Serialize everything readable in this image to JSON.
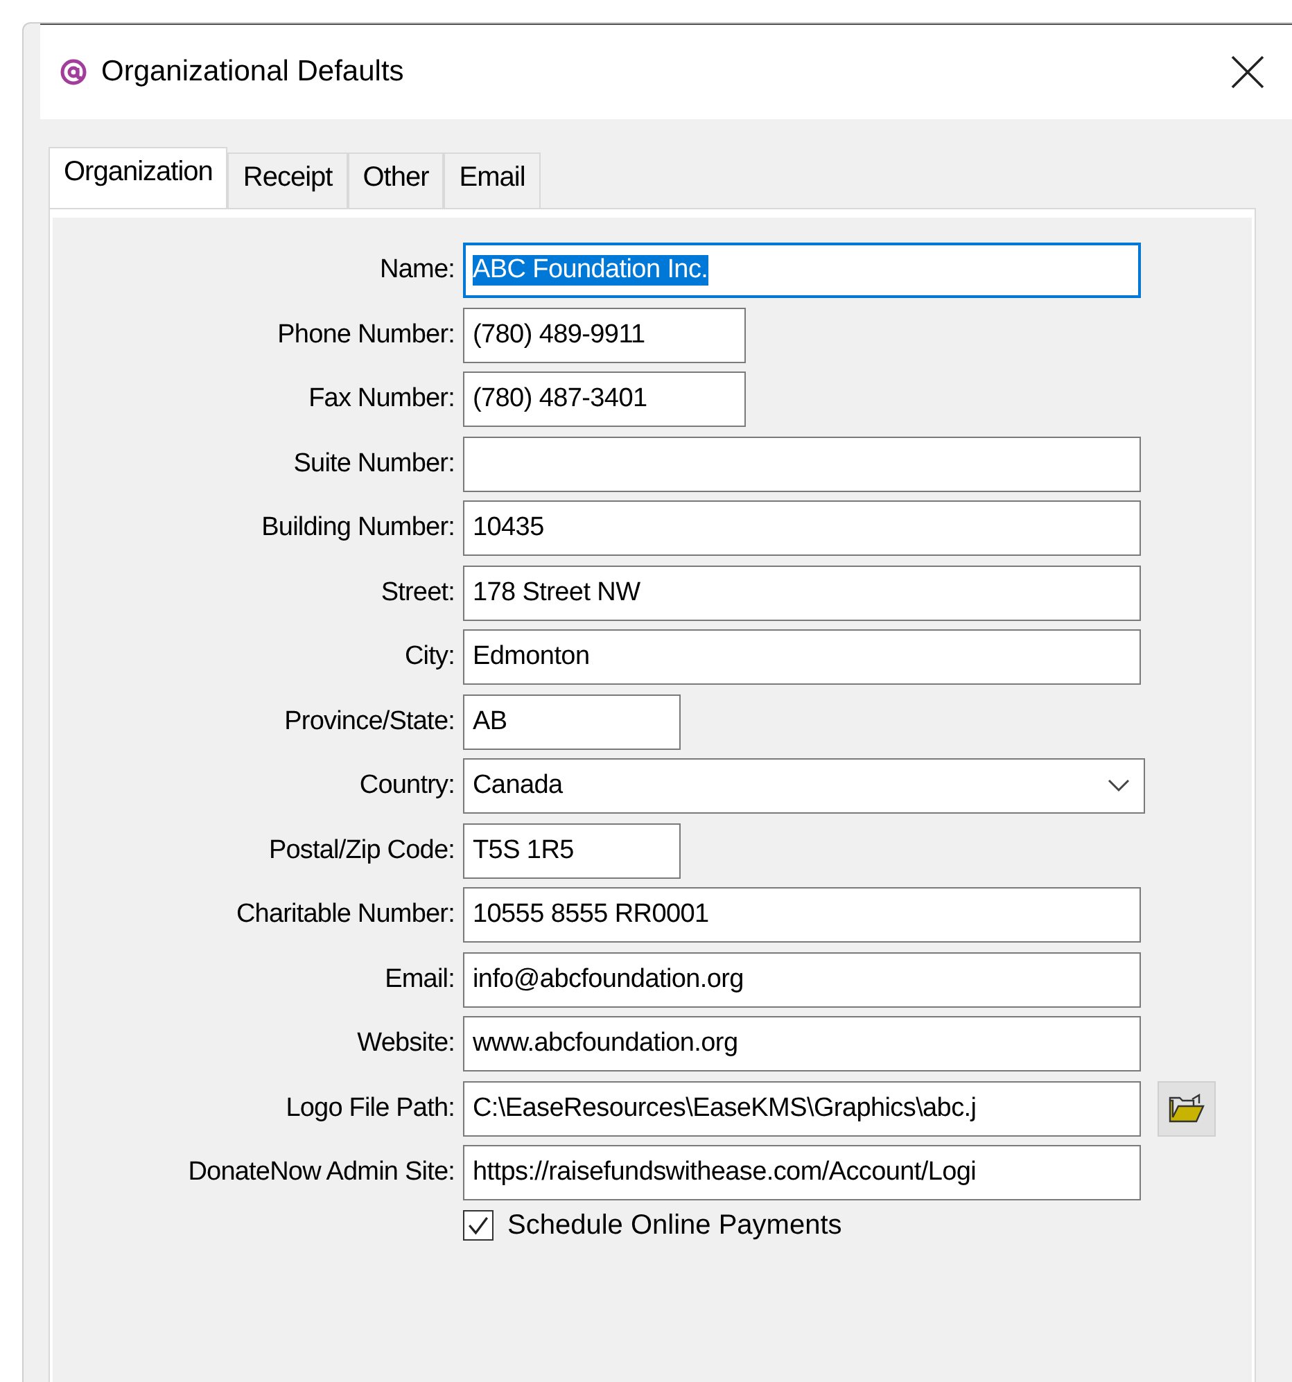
{
  "window": {
    "title": "Organizational Defaults"
  },
  "tabs": [
    {
      "label": "Organization",
      "selected": true
    },
    {
      "label": "Receipt",
      "selected": false
    },
    {
      "label": "Other",
      "selected": false
    },
    {
      "label": "Email",
      "selected": false
    }
  ],
  "fields": [
    {
      "label": "Name:",
      "value": "ABC Foundation Inc.",
      "kind": "text",
      "focused": true
    },
    {
      "label": "Phone Number:",
      "value": "(780) 489-9911",
      "kind": "short",
      "focused": false
    },
    {
      "label": "Fax Number:",
      "value": "(780) 487-3401",
      "kind": "short",
      "focused": false
    },
    {
      "label": "Suite Number:",
      "kind": "text",
      "focused": false
    },
    {
      "label": "Building Number:",
      "value": "10435",
      "kind": "text",
      "focused": false
    },
    {
      "label": "Street:",
      "value": "178 Street NW",
      "kind": "text",
      "focused": false
    },
    {
      "label": "City:",
      "value": "Edmonton",
      "kind": "text",
      "focused": false
    },
    {
      "label": "Province/State:",
      "value": "AB",
      "kind": "tiny",
      "focused": false
    },
    {
      "label": "Country:",
      "value": "Canada",
      "kind": "combo",
      "focused": false
    },
    {
      "label": "Postal/Zip Code:",
      "value": "T5S 1R5",
      "kind": "tiny",
      "focused": false
    },
    {
      "label": "Charitable Number:",
      "value": "10555 8555 RR0001",
      "kind": "text",
      "focused": false
    },
    {
      "label": "Email:",
      "value": "info@abcfoundation.org",
      "kind": "text",
      "focused": false
    },
    {
      "label": "Website:",
      "value": "www.abcfoundation.org",
      "kind": "text",
      "focused": false
    },
    {
      "label": "Logo File Path:",
      "value": "C:\\EaseResources\\EaseKMS\\Graphics\\abc.j",
      "kind": "file",
      "focused": false
    },
    {
      "label": "DonateNow Admin Site:",
      "value": "https://raisefundswithease.com/Account/Logi",
      "kind": "text",
      "focused": false
    }
  ],
  "checkbox": {
    "label": "Schedule Online Payments",
    "checked": true
  }
}
